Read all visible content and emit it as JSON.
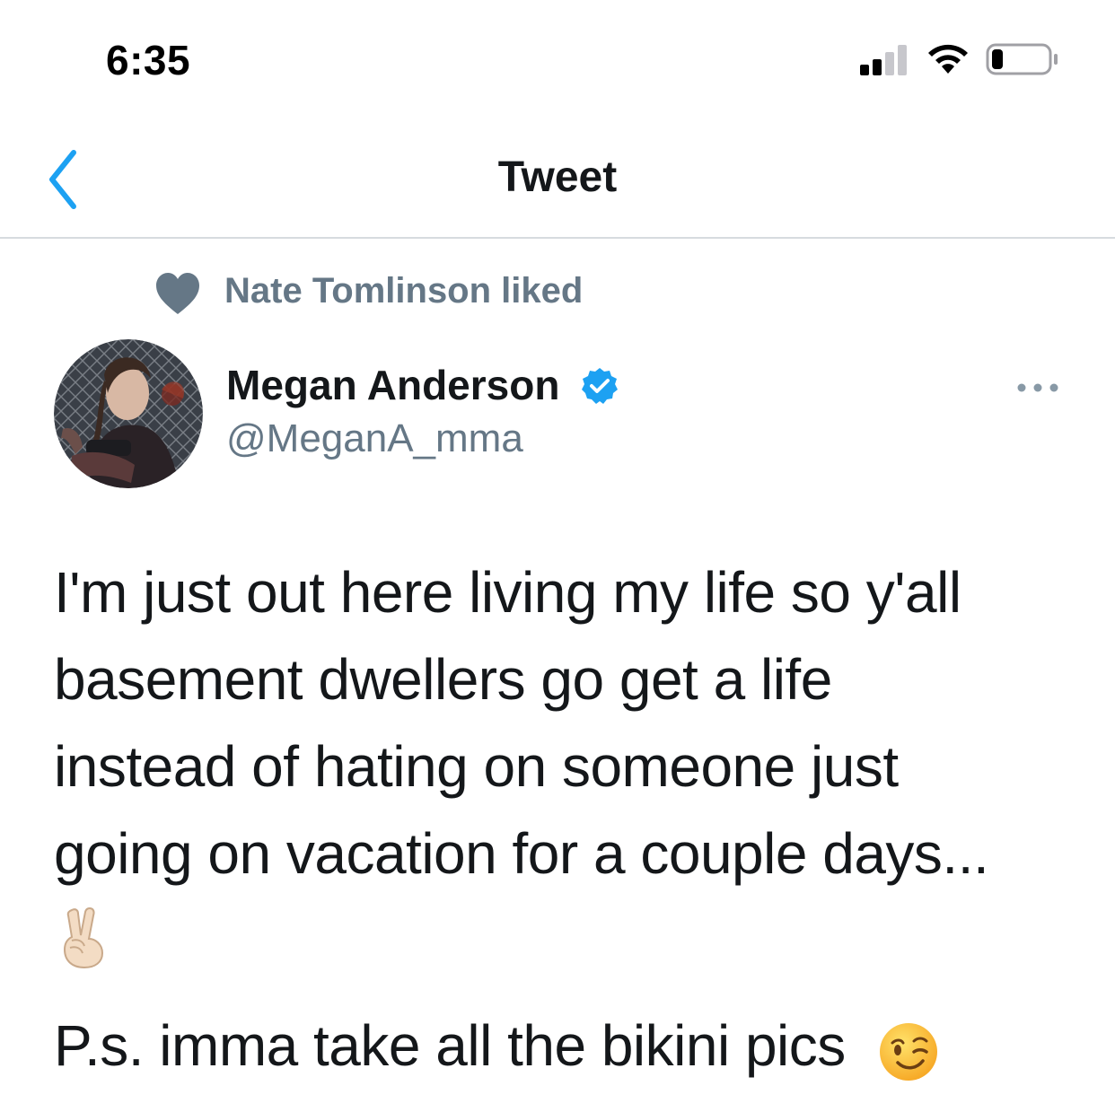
{
  "status_bar": {
    "time": "6:35",
    "signal_icon": "cellular-signal-icon",
    "wifi_icon": "wifi-icon",
    "battery_icon": "battery-icon",
    "battery_level": 0.2
  },
  "nav": {
    "back_icon": "chevron-left-icon",
    "title": "Tweet"
  },
  "social_context": {
    "icon": "heart-icon",
    "text": "Nate Tomlinson liked"
  },
  "author": {
    "name": "Megan Anderson",
    "verified": true,
    "handle": "@MeganA_mma",
    "avatar_icon": "avatar-illustration"
  },
  "more_icon": "more-options-icon",
  "tweet": {
    "lines": [
      "I'm just out here living my life so y'all",
      "basement dwellers go get a life",
      "instead of hating on someone just",
      "going on vacation for a couple days..."
    ],
    "peace_emoji": "victory-hand-emoji",
    "ps": "P.s. imma take all the bikini pics",
    "wink_emoji": "winking-face-emoji"
  },
  "colors": {
    "text_primary": "#14171a",
    "text_secondary": "#657786",
    "accent_blue": "#1da1f2",
    "divider": "#d7dbdf"
  }
}
